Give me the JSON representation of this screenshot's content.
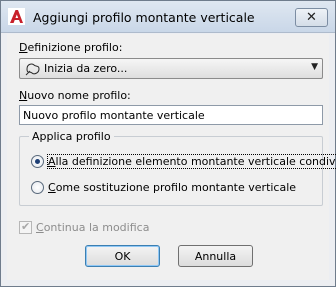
{
  "window": {
    "title": "Aggiungi profilo montante verticale",
    "close_symbol": "✕"
  },
  "profile_definition": {
    "label_prefix": "D",
    "label_rest": "efinizione profilo:",
    "selected_value": "Inizia da zero...",
    "icon": "freeform-shape-icon"
  },
  "new_name": {
    "label_prefix": "N",
    "label_rest": "uovo nome profilo:",
    "value": "Nuovo profilo montante verticale"
  },
  "apply_group": {
    "title": "Applica profilo",
    "options": [
      {
        "prefix": "A",
        "rest": "lla definizione elemento montante verticale condivisa",
        "checked": true
      },
      {
        "prefix": "C",
        "rest": "ome sostituzione profilo montante verticale",
        "checked": false
      }
    ]
  },
  "continue_edit": {
    "prefix": "C",
    "rest": "ontinua la modifica",
    "checked": true,
    "disabled": true
  },
  "buttons": {
    "ok": "OK",
    "cancel": "Annulla"
  },
  "colors": {
    "app_icon_red": "#c8202a",
    "default_button_border": "#3c7fb1"
  }
}
